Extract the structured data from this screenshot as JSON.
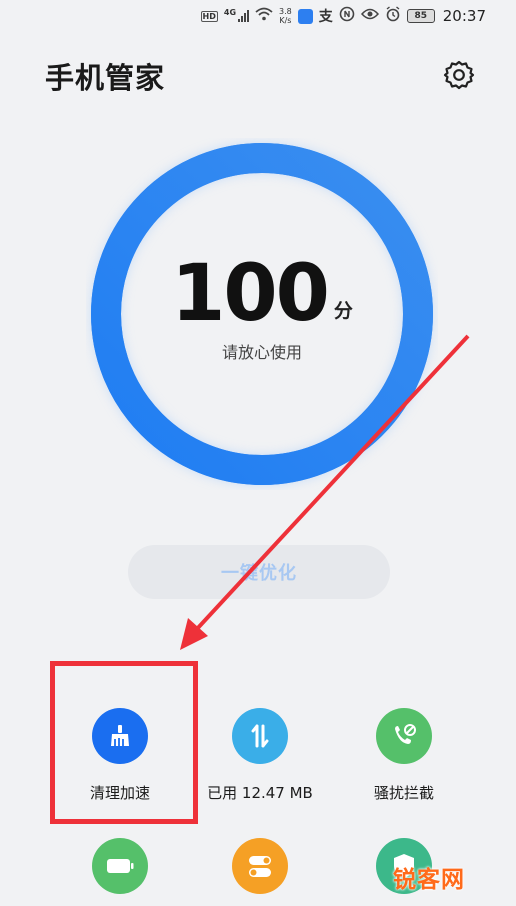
{
  "status_bar": {
    "hd": "HD",
    "network": "4G",
    "speed_value": "3.8",
    "speed_unit": "K/s",
    "alipay": "支",
    "battery": "85",
    "time": "20:37"
  },
  "header": {
    "title": "手机管家"
  },
  "score": {
    "value": "100",
    "unit": "分",
    "status": "请放心使用",
    "level": 1.0
  },
  "optimize_button": {
    "label": "一键优化"
  },
  "tools": [
    {
      "id": "clean",
      "label": "清理加速",
      "icon": "broom-icon",
      "color": "#1a6ef0"
    },
    {
      "id": "traffic",
      "label": "已用 12.47 MB",
      "icon": "data-traffic-icon",
      "color": "#3aaee8"
    },
    {
      "id": "block",
      "label": "骚扰拦截",
      "icon": "call-block-icon",
      "color": "#55c06a"
    },
    {
      "id": "battery",
      "label": "",
      "icon": "battery-icon",
      "color": "#55c06a"
    },
    {
      "id": "apps",
      "label": "",
      "icon": "toggle-icon",
      "color": "#f5a025"
    },
    {
      "id": "security",
      "label": "",
      "icon": "shield-icon",
      "color": "#3cb88a"
    }
  ],
  "watermark": "锐客网",
  "colors": {
    "ring": "#2b86f2",
    "annotation": "#ee3139",
    "background": "#f1f2f4"
  }
}
